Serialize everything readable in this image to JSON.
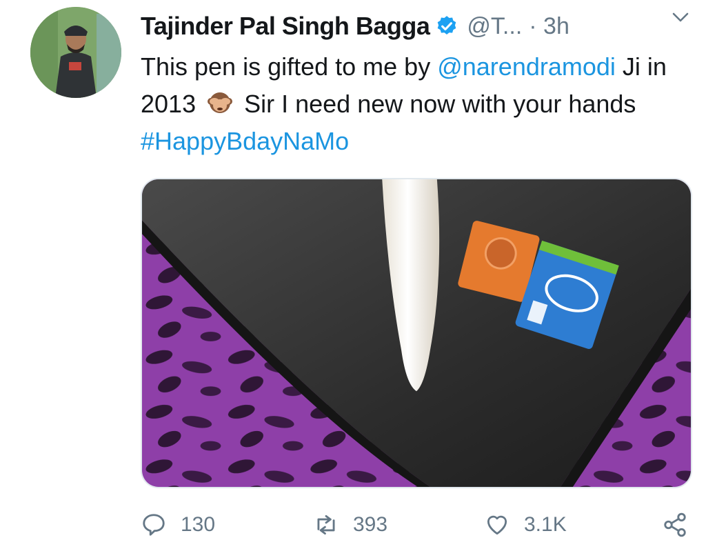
{
  "tweet": {
    "author_name": "Tajinder Pal Singh Bagga",
    "handle": "@T...",
    "time": "· 3h",
    "text": {
      "part1": "This pen is gifted to me by ",
      "mention": "@narendramodi",
      "part2": " Ji in 2013 ",
      "part3": " Sir I need new now with your hands ",
      "hashtag": "#HappyBdayNaMo"
    }
  },
  "actions": {
    "reply_count": "130",
    "retweet_count": "393",
    "like_count": "3.1K"
  },
  "colors": {
    "link": "#1b95e0",
    "verified": "#1da1f2",
    "muted": "#657786"
  },
  "icons": [
    "verified-badge-icon",
    "chevron-down-icon",
    "see-no-evil-monkey-emoji",
    "reply-icon",
    "retweet-icon",
    "like-icon",
    "share-icon"
  ]
}
